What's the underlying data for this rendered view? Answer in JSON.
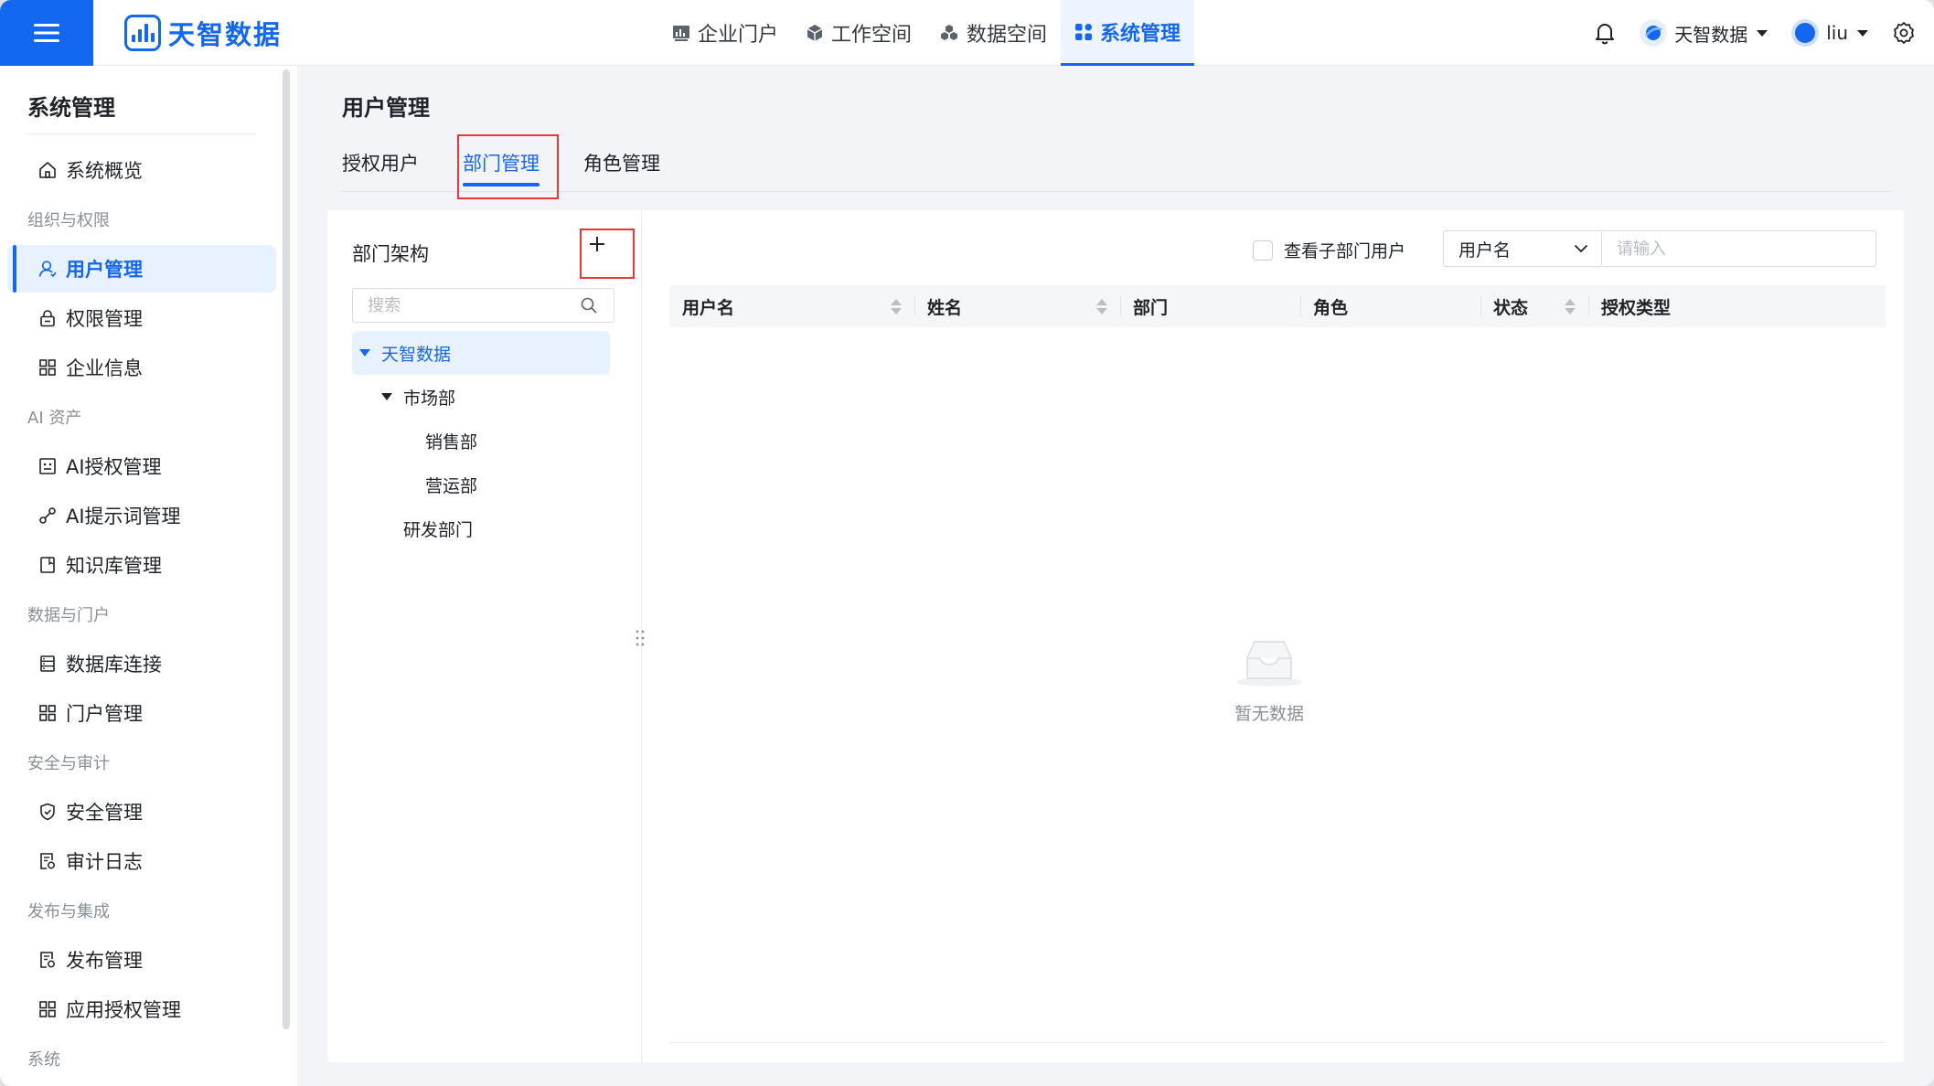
{
  "app": {
    "logo_text": "天智数据",
    "brand_color": "#1468ef"
  },
  "nav": {
    "items": [
      {
        "label": "企业门户",
        "icon": "chart-icon"
      },
      {
        "label": "工作空间",
        "icon": "cube-icon"
      },
      {
        "label": "数据空间",
        "icon": "cubes-icon"
      },
      {
        "label": "系统管理",
        "icon": "grid-icon",
        "active": true
      }
    ]
  },
  "topright": {
    "org_name": "天智数据",
    "user_name": "liu"
  },
  "sidebar": {
    "title": "系统管理",
    "overview": "系统概览",
    "groups": [
      {
        "label": "组织与权限",
        "items": [
          "用户管理",
          "权限管理",
          "企业信息"
        ]
      },
      {
        "label": "AI 资产",
        "items": [
          "AI授权管理",
          "AI提示词管理",
          "知识库管理"
        ]
      },
      {
        "label": "数据与门户",
        "items": [
          "数据库连接",
          "门户管理"
        ]
      },
      {
        "label": "安全与审计",
        "items": [
          "安全管理",
          "审计日志"
        ]
      },
      {
        "label": "发布与集成",
        "items": [
          "发布管理",
          "应用授权管理"
        ]
      },
      {
        "label": "系统",
        "items": []
      }
    ]
  },
  "main": {
    "title": "用户管理",
    "tabs": [
      "授权用户",
      "部门管理",
      "角色管理"
    ],
    "active_tab": "部门管理"
  },
  "tree": {
    "title": "部门架构",
    "search_placeholder": "搜索",
    "nodes": [
      {
        "label": "天智数据",
        "level": 0,
        "expanded": true,
        "selected": true
      },
      {
        "label": "市场部",
        "level": 1,
        "expanded": true
      },
      {
        "label": "销售部",
        "level": 2
      },
      {
        "label": "营运部",
        "level": 2
      },
      {
        "label": "研发部门",
        "level": 1
      }
    ]
  },
  "table": {
    "sub_dept_checkbox_label": "查看子部门用户",
    "field_select_value": "用户名",
    "search_placeholder": "请输入",
    "columns": [
      "用户名",
      "姓名",
      "部门",
      "角色",
      "状态",
      "授权类型"
    ],
    "rows": [],
    "empty_text": "暂无数据"
  },
  "highlight_color": "#e53935"
}
